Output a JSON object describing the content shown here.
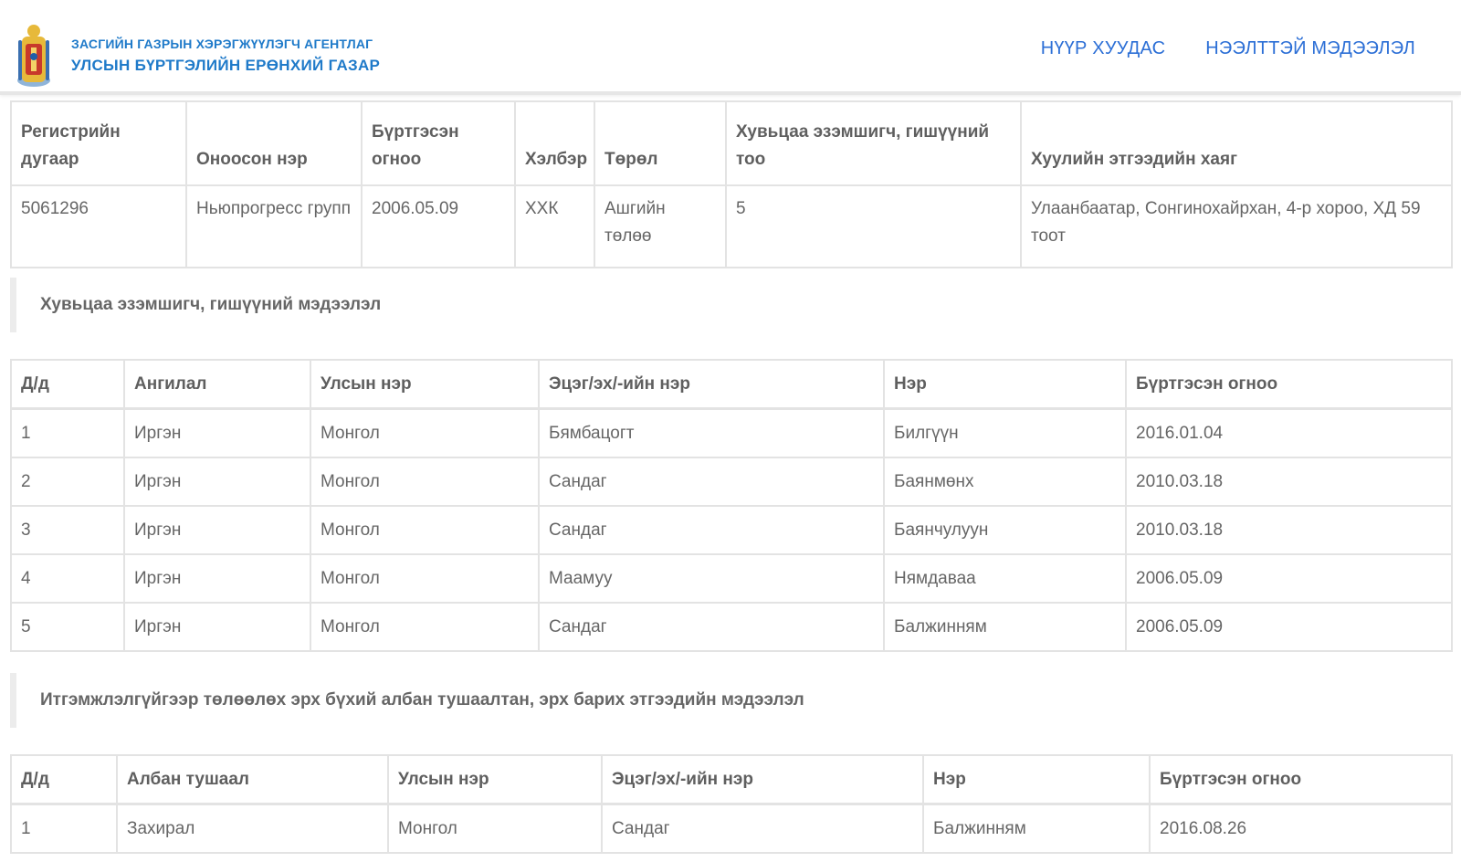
{
  "header": {
    "agency_line1": "ЗАСГИЙН ГАЗРЫН ХЭРЭГЖҮҮЛЭГЧ АГЕНТЛАГ",
    "agency_line2": "УЛСЫН БҮРТГЭЛИЙН ЕРӨНХИЙ ГАЗАР",
    "nav": [
      "НҮҮР ХУУДАС",
      "НЭЭЛТТЭЙ МЭДЭЭЛЭЛ"
    ],
    "colors": {
      "brand": "#1f7ac9",
      "nav": "#2c6fd6",
      "logo_gold": "#e7b93a"
    }
  },
  "company": {
    "headers": [
      "Регистрийн дугаар",
      "Оноосон нэр",
      "Бүртгэсэн огноо",
      "Хэлбэр",
      "Төрөл",
      "Хувьцаа эзэмшигч, гишүүний тоо",
      "Хуулийн этгээдийн хаяг"
    ],
    "row": [
      "5061296",
      "Ньюпрогресс групп",
      "2006.05.09",
      "ХХК",
      "Ашгийн төлөө",
      "5",
      "Улаанбаатар, Сонгинохайрхан, 4-р хороо, ХД 59 тоот"
    ]
  },
  "shareholders": {
    "title": "Хувьцаа эзэмшигч, гишүүний мэдээлэл",
    "headers": [
      "Д/д",
      "Ангилал",
      "Улсын нэр",
      "Эцэг/эх/-ийн нэр",
      "Нэр",
      "Бүртгэсэн огноо"
    ],
    "rows": [
      [
        "1",
        "Иргэн",
        "Монгол",
        "Бямбацогт",
        "Билгүүн",
        "2016.01.04"
      ],
      [
        "2",
        "Иргэн",
        "Монгол",
        "Сандаг",
        "Баянмөнх",
        "2010.03.18"
      ],
      [
        "3",
        "Иргэн",
        "Монгол",
        "Сандаг",
        "Баянчулуун",
        "2010.03.18"
      ],
      [
        "4",
        "Иргэн",
        "Монгол",
        "Маамуу",
        "Нямдаваа",
        "2006.05.09"
      ],
      [
        "5",
        "Иргэн",
        "Монгол",
        "Сандаг",
        "Балжинням",
        "2006.05.09"
      ]
    ]
  },
  "officials": {
    "title": "Итгэмжлэлгүйгээр төлөөлөх эрх бүхий албан тушаалтан, эрх барих этгээдийн мэдээлэл",
    "headers": [
      "Д/д",
      "Албан тушаал",
      "Улсын нэр",
      "Эцэг/эх/-ийн нэр",
      "Нэр",
      "Бүртгэсэн огноо"
    ],
    "rows": [
      [
        "1",
        "Захирал",
        "Монгол",
        "Сандаг",
        "Балжинням",
        "2016.08.26"
      ]
    ]
  }
}
